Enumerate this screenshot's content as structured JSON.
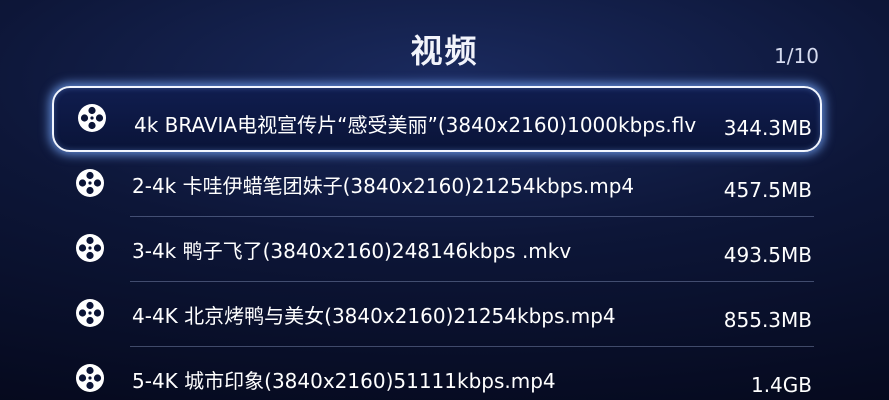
{
  "header": {
    "title": "视频",
    "page_indicator": "1/10"
  },
  "files": [
    {
      "name": "4k BRAVIA电视宣传片“感受美丽”(3840x2160)1000kbps.flv",
      "size": "344.3MB",
      "selected": true
    },
    {
      "name": "2-4k 卡哇伊蜡笔团妹子(3840x2160)21254kbps.mp4",
      "size": "457.5MB",
      "selected": false
    },
    {
      "name": "3-4k 鸭子飞了(3840x2160)248146kbps .mkv",
      "size": "493.5MB",
      "selected": false
    },
    {
      "name": "4-4K 北京烤鸭与美女(3840x2160)21254kbps.mp4",
      "size": "855.3MB",
      "selected": false
    },
    {
      "name": "5-4K 城市印象(3840x2160)51111kbps.mp4",
      "size": "1.4GB",
      "selected": false
    }
  ],
  "icons": {
    "file_icon": "film-reel-icon"
  },
  "colors": {
    "highlight_border": "#f2f6ff",
    "highlight_glow": "#78aaff",
    "background_top": "#1a2a5e",
    "background_bottom": "#05091d"
  }
}
